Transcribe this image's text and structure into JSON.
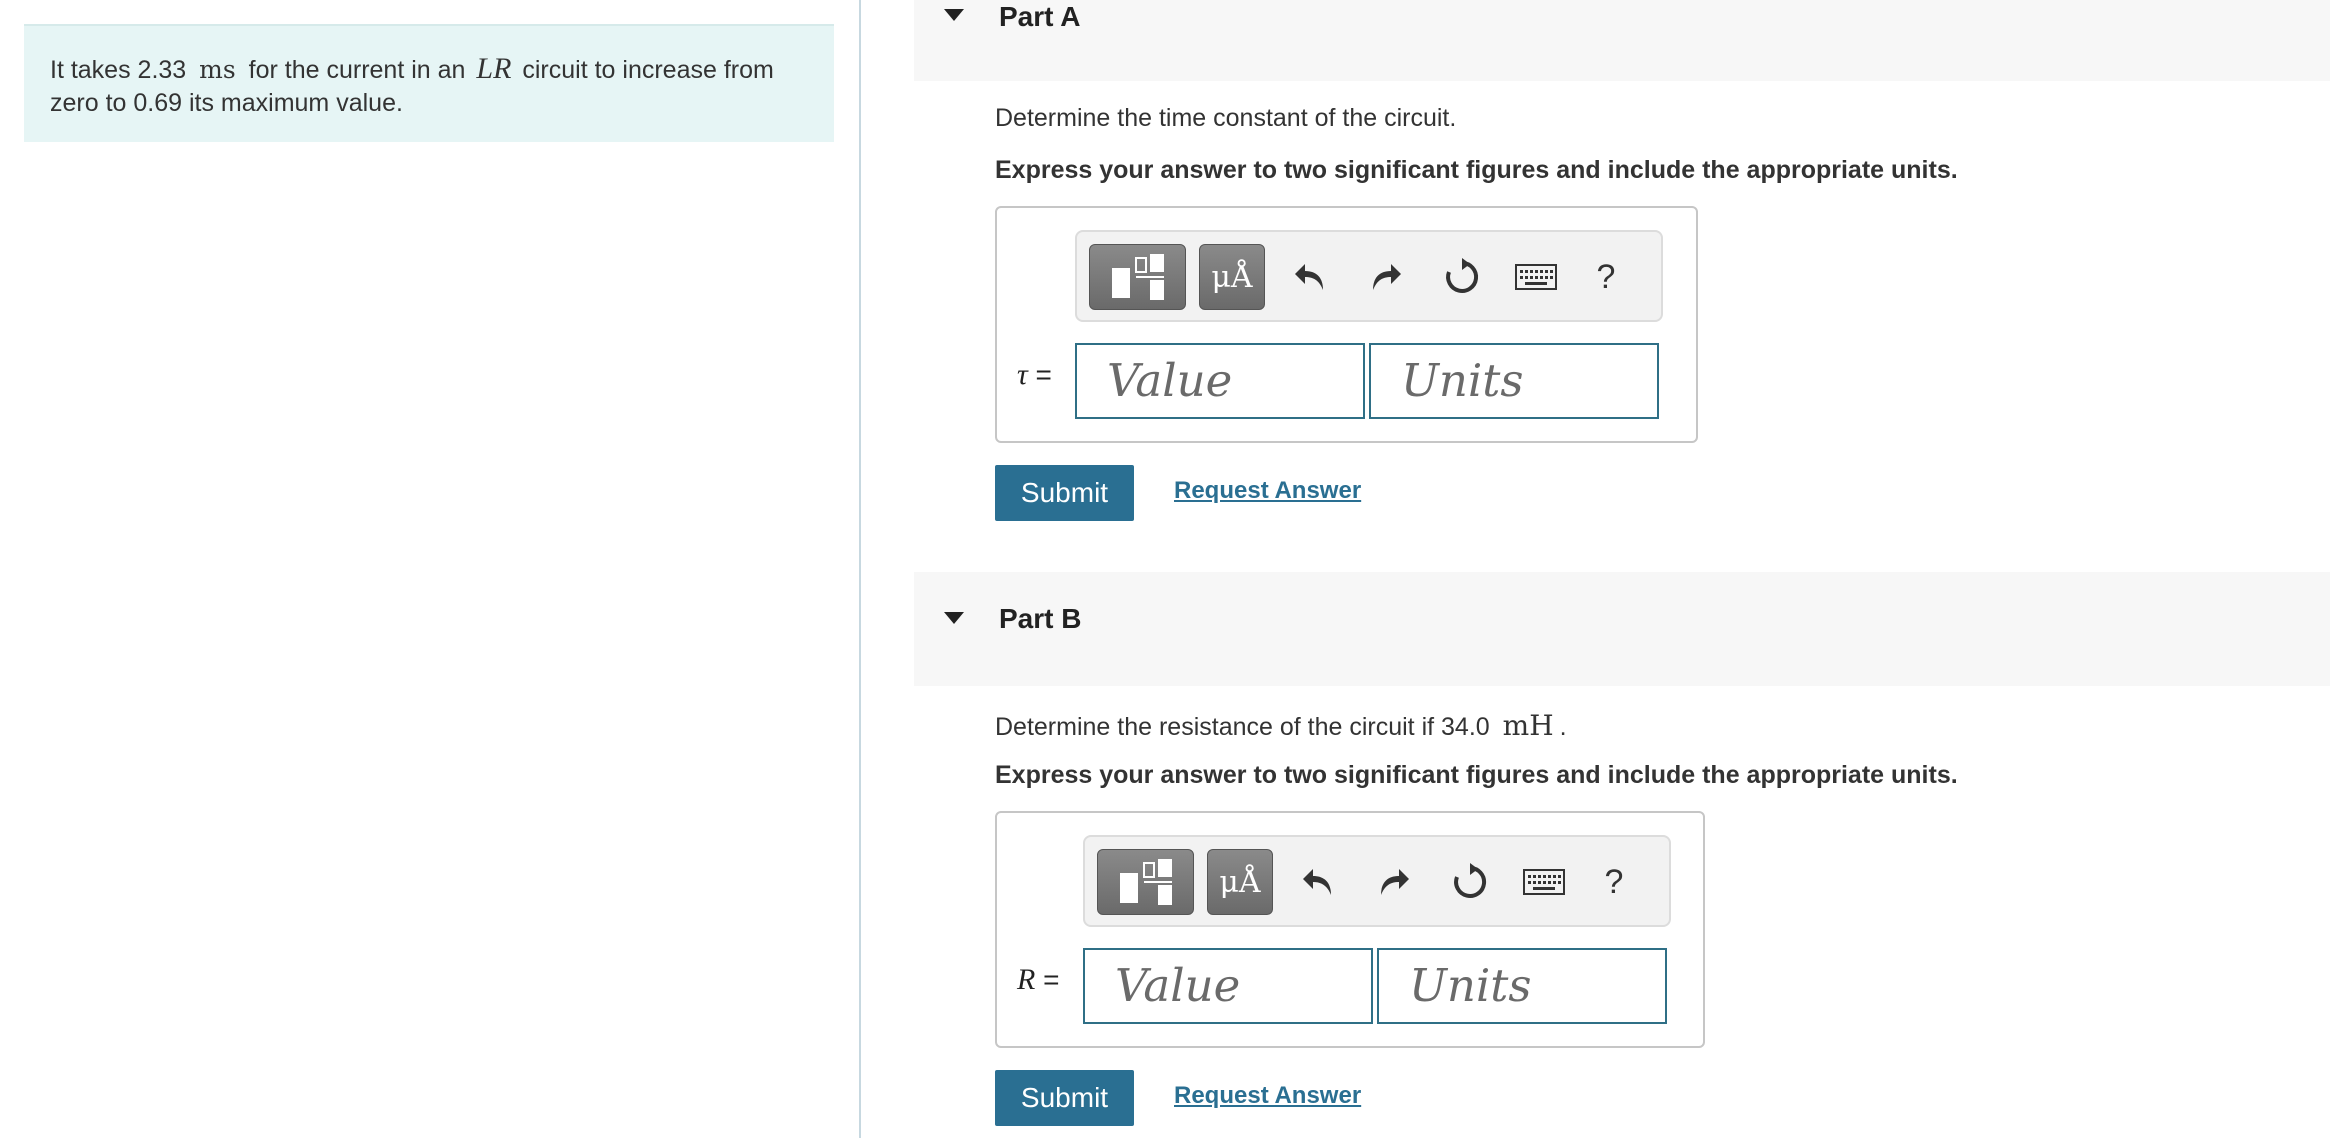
{
  "problem": {
    "text_before": "It takes 2.33",
    "time_unit": "ms",
    "text_middle": "for the current in an",
    "circuit_symbol": "LR",
    "text_after": "circuit to increase from zero to 0.69 its maximum value."
  },
  "parts": [
    {
      "title": "Part A",
      "question": "Determine the time constant of the circuit.",
      "instruction": "Express your answer to two significant figures and include the appropriate units.",
      "variable": "τ",
      "equals": "=",
      "value_placeholder": "Value",
      "units_placeholder": "Units",
      "submit_label": "Submit",
      "request_label": "Request Answer"
    },
    {
      "title": "Part B",
      "question_before": "Determine the resistance of the circuit if 34.0",
      "question_unit": "mH",
      "question_after": ".",
      "instruction": "Express your answer to two significant figures and include the appropriate units.",
      "variable": "R",
      "equals": "=",
      "value_placeholder": "Value",
      "units_placeholder": "Units",
      "submit_label": "Submit",
      "request_label": "Request Answer"
    }
  ],
  "toolbar": {
    "symbols_label": "μÅ",
    "help_label": "?",
    "icons": [
      "templates-icon",
      "symbols-icon",
      "undo-icon",
      "redo-icon",
      "reset-icon",
      "keyboard-icon",
      "help-icon"
    ]
  },
  "colors": {
    "accent": "#2a6f92",
    "problem_background": "#e6f5f5",
    "part_header_background": "#f7f7f7"
  }
}
